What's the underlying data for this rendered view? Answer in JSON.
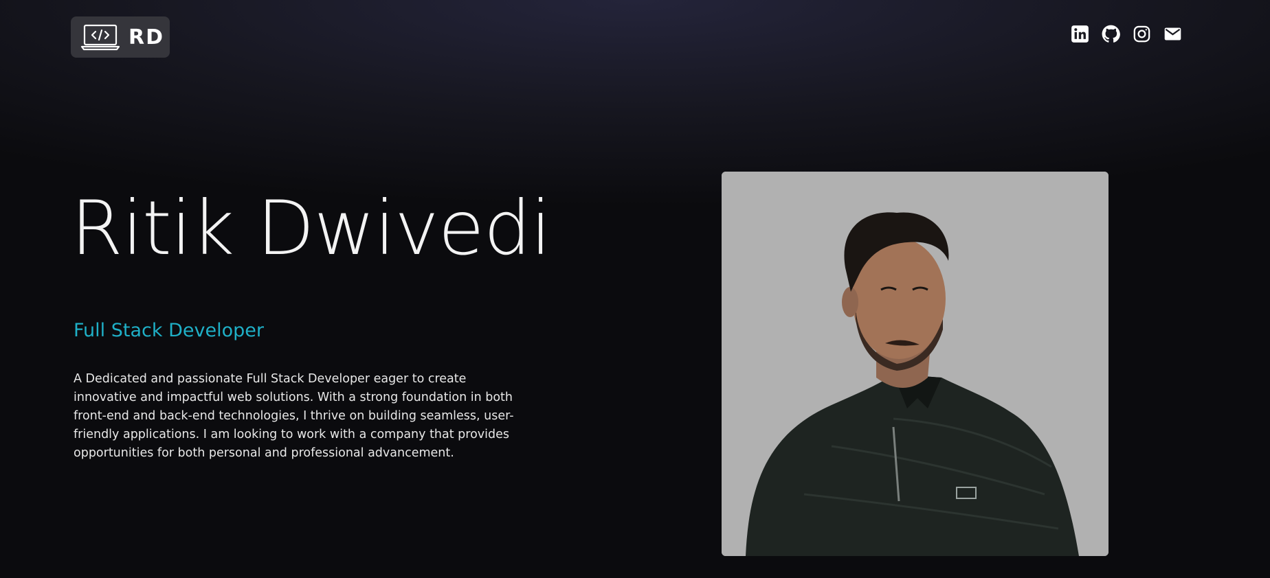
{
  "header": {
    "logo_text": "RD",
    "social": [
      {
        "name": "linkedin-icon"
      },
      {
        "name": "github-icon"
      },
      {
        "name": "instagram-icon"
      },
      {
        "name": "mail-icon"
      }
    ]
  },
  "hero": {
    "name": "Ritik Dwivedi",
    "role": "Full Stack Developer",
    "bio": "A Dedicated and passionate Full Stack Developer eager to create innovative and impactful web solutions. With a strong foundation in both front-end and back-end technologies, I thrive on building seamless, user-friendly applications. I am looking to work with a company that provides opportunities for both personal and professional advancement."
  },
  "colors": {
    "accent": "#1fb0c7",
    "background": "#0b0b0e",
    "photo_bg": "#b1b1b1"
  }
}
